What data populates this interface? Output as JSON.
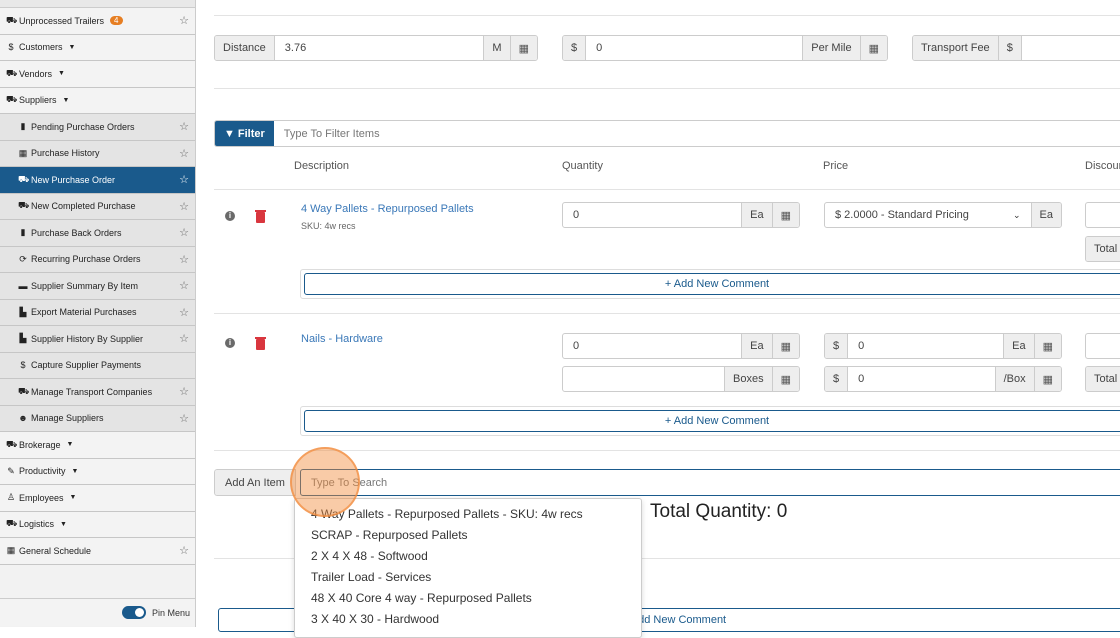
{
  "sidebar": {
    "items": [
      {
        "icon": "trailer-icon",
        "glyph": "⛟",
        "label": "Unprocessed Trailers",
        "badge": "4",
        "star": true,
        "sub": false,
        "caret": false
      },
      {
        "icon": "dollar-icon",
        "glyph": "$",
        "label": "Customers",
        "star": false,
        "sub": false,
        "caret": true
      },
      {
        "icon": "truck-icon",
        "glyph": "⛟",
        "label": "Vendors",
        "star": false,
        "sub": false,
        "caret": true
      },
      {
        "icon": "truck-icon",
        "glyph": "⛟",
        "label": "Suppliers",
        "star": false,
        "sub": false,
        "caret": true
      },
      {
        "icon": "clipboard-icon",
        "glyph": "▮",
        "label": "Pending Purchase Orders",
        "star": true,
        "sub": true
      },
      {
        "icon": "table-icon",
        "glyph": "▦",
        "label": "Purchase History",
        "star": true,
        "sub": true
      },
      {
        "icon": "dolly-icon",
        "glyph": "⛟",
        "label": "New Purchase Order",
        "star": true,
        "sub": true,
        "active": true
      },
      {
        "icon": "truck-icon",
        "glyph": "⛟",
        "label": "New Completed Purchase",
        "star": true,
        "sub": true
      },
      {
        "icon": "clipboard-icon",
        "glyph": "▮",
        "label": "Purchase Back Orders",
        "star": true,
        "sub": true
      },
      {
        "icon": "refresh-icon",
        "glyph": "⟳",
        "label": "Recurring Purchase Orders",
        "star": true,
        "sub": true
      },
      {
        "icon": "ruler-icon",
        "glyph": "▬",
        "label": "Supplier Summary By Item",
        "star": true,
        "sub": true
      },
      {
        "icon": "file-export-icon",
        "glyph": "▙",
        "label": "Export Material Purchases",
        "star": true,
        "sub": true
      },
      {
        "icon": "chart-icon",
        "glyph": "▙",
        "label": "Supplier History By Supplier",
        "star": true,
        "sub": true
      },
      {
        "icon": "dollar-icon",
        "glyph": "$",
        "label": "Capture Supplier Payments",
        "star": false,
        "sub": true
      },
      {
        "icon": "truck-icon",
        "glyph": "⛟",
        "label": "Manage Transport Companies",
        "star": true,
        "sub": true
      },
      {
        "icon": "users-icon",
        "glyph": "☻",
        "label": "Manage Suppliers",
        "star": true,
        "sub": true
      },
      {
        "icon": "truck-icon",
        "glyph": "⛟",
        "label": "Brokerage",
        "star": false,
        "sub": false,
        "caret": true
      },
      {
        "icon": "wrench-icon",
        "glyph": "✎",
        "label": "Productivity",
        "star": false,
        "sub": false,
        "caret": true
      },
      {
        "icon": "person-icon",
        "glyph": "♙",
        "label": "Employees",
        "star": false,
        "sub": false,
        "caret": true
      },
      {
        "icon": "truck-icon",
        "glyph": "⛟",
        "label": "Logistics",
        "star": false,
        "sub": false,
        "caret": true
      },
      {
        "icon": "calendar-icon",
        "glyph": "▦",
        "label": "General Schedule",
        "star": true,
        "sub": false
      }
    ],
    "pin_label": "Pin Menu"
  },
  "transport": {
    "distance_label": "Distance",
    "distance_value": "3.76",
    "distance_unit": "M",
    "rate_prefix": "$",
    "rate_value": "0",
    "rate_unit": "Per Mile",
    "fee_label": "Transport Fee",
    "fee_prefix": "$"
  },
  "filter": {
    "button": "Filter",
    "placeholder": "Type To Filter Items"
  },
  "columns": {
    "description": "Description",
    "quantity": "Quantity",
    "price": "Price",
    "discount": "Discour"
  },
  "items": [
    {
      "name": "4 Way Pallets - Repurposed Pallets",
      "sku": "SKU: 4w recs",
      "qty": "0",
      "qty_unit": "Ea",
      "price_select": "$ 2.0000 - Standard Pricing",
      "price_unit": "Ea",
      "total_label": "Total",
      "comment": "+ Add New Comment"
    },
    {
      "name": "Nails - Hardware",
      "qty": "0",
      "qty_unit": "Ea",
      "boxes_unit": "Boxes",
      "price_prefix": "$",
      "price_value": "0",
      "price_unit": "Ea",
      "box_price_prefix": "$",
      "box_price_value": "0",
      "box_price_unit": "/Box",
      "total_label": "Total",
      "comment": "+ Add New Comment"
    }
  ],
  "add_item": {
    "label": "Add An Item",
    "placeholder": "Type To Search",
    "suggestions": [
      "4 Way Pallets - Repurposed Pallets - SKU: 4w recs",
      "SCRAP - Repurposed Pallets",
      "2 X 4 X 48 - Softwood",
      "Trailer Load - Services",
      "48 X 40 Core 4 way - Repurposed Pallets",
      "3 X 40 X 30 - Hardwood"
    ]
  },
  "total_quantity": "Total Quantity: 0",
  "bottom_comment": "+ Add New Comment",
  "colors": {
    "primary": "#1a5a8c",
    "link": "#3a78b8",
    "danger": "#d9363e",
    "badge": "#e67e22"
  }
}
